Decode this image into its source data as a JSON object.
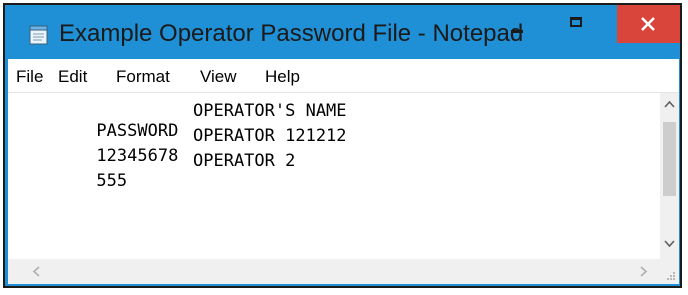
{
  "window": {
    "title": "Example Operator Password File - Notepad"
  },
  "menu": {
    "items": [
      "File",
      "Edit",
      "Format",
      "View",
      "Help"
    ]
  },
  "document": {
    "lines": [
      {
        "col1": "PASSWORD",
        "col2": "OPERATOR'S NAME"
      },
      {
        "col1": "12345678",
        "col2": "OPERATOR 121212"
      },
      {
        "col1": "555",
        "col2": "OPERATOR 2"
      }
    ]
  },
  "colors": {
    "titlebar": "#1f8fd6",
    "close_button": "#d9443b",
    "scrollbar_track": "#f0f0f0",
    "scrollbar_thumb": "#cdcdcd"
  },
  "icons": {
    "app": "notepad-icon",
    "minimize": "minimize-icon",
    "maximize": "maximize-icon",
    "close": "close-icon",
    "scroll_up": "chevron-up-icon",
    "scroll_down": "chevron-down-icon",
    "scroll_left": "chevron-left-icon",
    "scroll_right": "chevron-right-icon",
    "resize_grip": "resize-grip-icon"
  }
}
